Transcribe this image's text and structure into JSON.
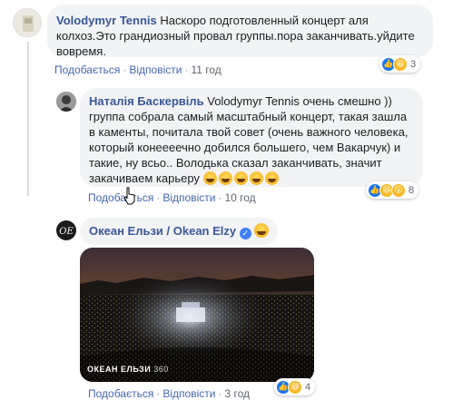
{
  "comments": [
    {
      "author": "Volodymyr Tennis",
      "text": "Наскоро подготовленный концерт аля колхоз.Это грандиозный провал группы.пора заканчивать.уйдите вовремя.",
      "like_label": "Подобається",
      "reply_label": "Відповісти",
      "time": "11 год",
      "reaction_count": "3",
      "reaction_icons": [
        "like-icon",
        "haha-icon"
      ]
    },
    {
      "author": "Наталія Баскервіль",
      "mention": "Volodymyr Tennis",
      "text": "очень смешно )) группа собрала самый масштабный концерт, такая зашла в каменты, почитала твой совет (очень важного человека, который конеееечно добился большего, чем Вакарчук) и такие, ну всьо.. Володька сказал заканчивать, значит закачиваем карьеру",
      "emoji": [
        "laughing-emoji",
        "laughing-emoji",
        "laughing-emoji",
        "laughing-emoji",
        "laughing-emoji"
      ],
      "like_label": "Подобається",
      "reply_label": "Відповісти",
      "time": "10 год",
      "reaction_count": "8",
      "reaction_icons": [
        "like-icon",
        "haha-icon",
        "wow-icon"
      ]
    },
    {
      "author": "Океан Ельзи / Okean Elzy",
      "verified_icon": "verified-badge-icon",
      "emoji": "smile-emoji",
      "image_caption": "ОКЕАН ЕЛЬЗИ",
      "image_caption_suffix": "360",
      "like_label": "Подобається",
      "reply_label": "Відповісти",
      "time": "3 год",
      "reaction_count": "4",
      "reaction_icons": [
        "like-icon",
        "haha-icon"
      ]
    }
  ],
  "colors": {
    "author": "#385898",
    "link": "#4267b2",
    "bubble": "#f2f3f5",
    "meta": "#606770",
    "like": "#1877f2",
    "haha": "#f7b928"
  }
}
